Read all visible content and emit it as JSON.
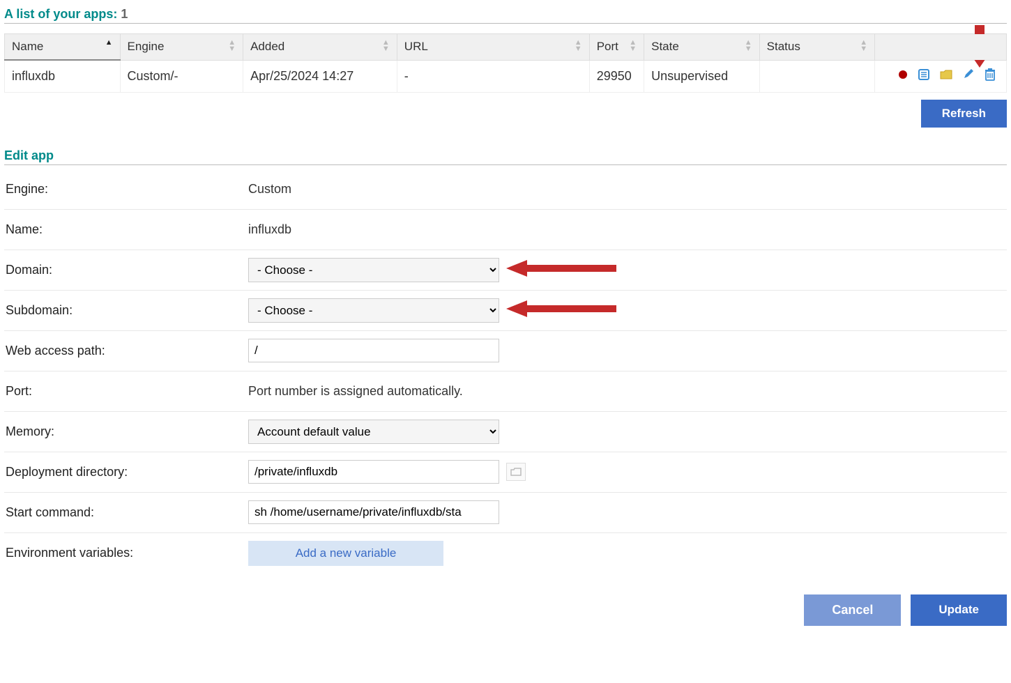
{
  "list": {
    "title_prefix": "A list of your apps:",
    "count": "1",
    "columns": {
      "name": "Name",
      "engine": "Engine",
      "added": "Added",
      "url": "URL",
      "port": "Port",
      "state": "State",
      "status": "Status"
    },
    "row": {
      "name": "influxdb",
      "engine": "Custom/-",
      "added": "Apr/25/2024 14:27",
      "url": "-",
      "port": "29950",
      "state": "Unsupervised",
      "status": ""
    },
    "refresh_label": "Refresh"
  },
  "edit": {
    "title": "Edit app",
    "labels": {
      "engine": "Engine:",
      "name": "Name:",
      "domain": "Domain:",
      "subdomain": "Subdomain:",
      "webpath": "Web access path:",
      "port": "Port:",
      "memory": "Memory:",
      "deploydir": "Deployment directory:",
      "startcmd": "Start command:",
      "envvars": "Environment variables:"
    },
    "values": {
      "engine": "Custom",
      "name": "influxdb",
      "domain_selected": "- Choose -",
      "subdomain_selected": "- Choose -",
      "webpath": "/",
      "port_note": "Port number is assigned automatically.",
      "memory_selected": "Account default value",
      "deploydir": "/private/influxdb",
      "startcmd": "sh /home/username/private/influxdb/sta"
    },
    "addvar_label": "Add a new variable",
    "cancel_label": "Cancel",
    "update_label": "Update"
  },
  "icons": {
    "status_dot": "status-dot",
    "log": "log-icon",
    "dir": "folder-icon",
    "edit": "edit-icon",
    "delete": "trash-icon"
  },
  "colors": {
    "teal": "#008a8a",
    "blue": "#3a6bc5",
    "arrow": "#c52a2a"
  }
}
